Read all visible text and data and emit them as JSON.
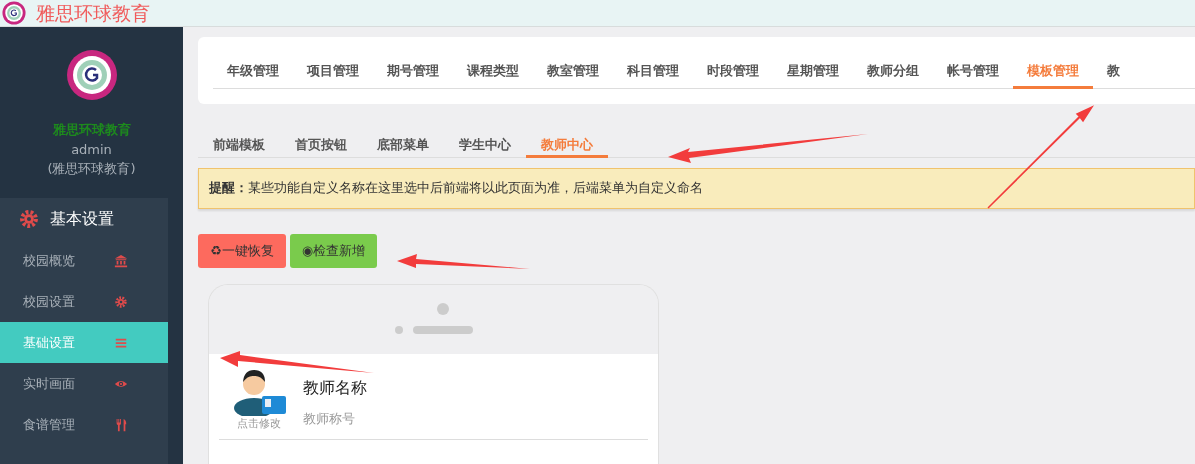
{
  "header": {
    "title": "雅思环球教育"
  },
  "sidebar": {
    "org_name": "雅思环球教育",
    "user": "admin",
    "user_org": "(雅思环球教育)",
    "group": {
      "label": "基本设置"
    },
    "items": [
      {
        "label": "校园概览",
        "kind": "bank",
        "selected": false
      },
      {
        "label": "校园设置",
        "kind": "gear",
        "selected": false
      },
      {
        "label": "基础设置",
        "kind": "bars",
        "selected": true
      },
      {
        "label": "实时画面",
        "kind": "eye",
        "selected": false
      },
      {
        "label": "食谱管理",
        "kind": "cutlery",
        "selected": false
      }
    ]
  },
  "tabs": [
    {
      "label": "年级管理",
      "selected": false
    },
    {
      "label": "项目管理",
      "selected": false
    },
    {
      "label": "期号管理",
      "selected": false
    },
    {
      "label": "课程类型",
      "selected": false
    },
    {
      "label": "教室管理",
      "selected": false
    },
    {
      "label": "科目管理",
      "selected": false
    },
    {
      "label": "时段管理",
      "selected": false
    },
    {
      "label": "星期管理",
      "selected": false
    },
    {
      "label": "教师分组",
      "selected": false
    },
    {
      "label": "帐号管理",
      "selected": false
    },
    {
      "label": "模板管理",
      "selected": true
    },
    {
      "label": "教",
      "selected": false
    }
  ],
  "subtabs": [
    {
      "label": "前端模板",
      "selected": false
    },
    {
      "label": "首页按钮",
      "selected": false
    },
    {
      "label": "底部菜单",
      "selected": false
    },
    {
      "label": "学生中心",
      "selected": false
    },
    {
      "label": "教师中心",
      "selected": true
    }
  ],
  "alert": {
    "text": "**提醒：**某些功能自定义名称在这里选中后前端将以此页面为准，后端菜单为自定义命名"
  },
  "buttons": [
    {
      "label": "♻一键恢复",
      "kind": "restore"
    },
    {
      "label": "◉检查新增",
      "kind": "check"
    }
  ],
  "preview": {
    "avatar_caption": "点击修改",
    "name": "教师名称",
    "title": "教师称号"
  }
}
